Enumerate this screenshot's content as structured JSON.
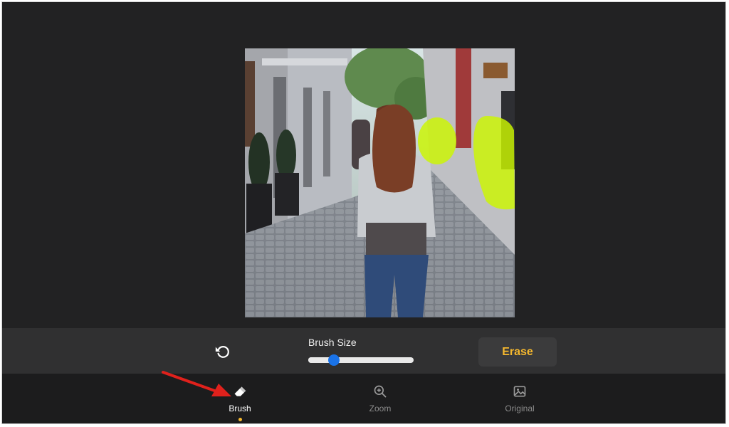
{
  "controls": {
    "brush_size_label": "Brush Size",
    "brush_size_value": 0.24,
    "erase_label": "Erase",
    "accent_color": "#f5b82e",
    "slider_color": "#1a73e8"
  },
  "tabs": [
    {
      "label": "Brush",
      "icon": "eraser-icon",
      "active": true
    },
    {
      "label": "Zoom",
      "icon": "zoom-in-icon",
      "active": false
    },
    {
      "label": "Original",
      "icon": "image-icon",
      "active": false
    }
  ],
  "annotation": {
    "arrow_color": "#e0211c"
  },
  "mask_color": "#ccf700"
}
